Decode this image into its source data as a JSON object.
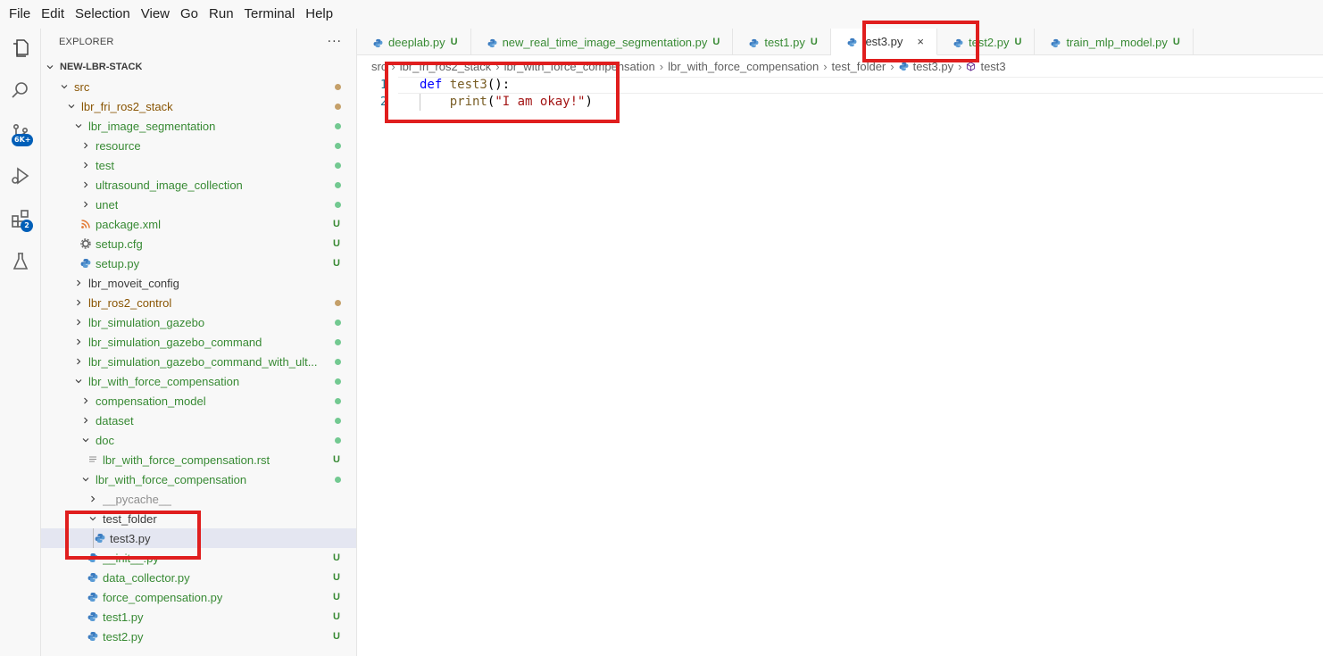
{
  "menu": [
    "File",
    "Edit",
    "Selection",
    "View",
    "Go",
    "Run",
    "Terminal",
    "Help"
  ],
  "activity": {
    "icons": [
      "explorer-icon",
      "search-icon",
      "source-control-icon",
      "run-debug-icon",
      "extensions-icon",
      "testing-icon"
    ],
    "scm_badge": "6K+",
    "extensions_badge": "2"
  },
  "sidebar": {
    "title": "EXPLORER",
    "more": "···",
    "tree": [
      {
        "label": "NEW-LBR-STACK",
        "indent": 0,
        "chevron": "down",
        "color": "c-bold",
        "deco": "",
        "dot": ""
      },
      {
        "label": "src",
        "indent": 1,
        "chevron": "down",
        "color": "c-olive",
        "deco": "",
        "dot": "#c5a06a"
      },
      {
        "label": "lbr_fri_ros2_stack",
        "indent": 2,
        "chevron": "down",
        "color": "c-olive",
        "deco": "",
        "dot": "#c5a06a"
      },
      {
        "label": "lbr_image_segmentation",
        "indent": 3,
        "chevron": "down",
        "color": "c-green",
        "deco": "",
        "dot": "#73c991"
      },
      {
        "label": "resource",
        "indent": 4,
        "chevron": "right",
        "color": "c-green",
        "deco": "",
        "dot": "#73c991"
      },
      {
        "label": "test",
        "indent": 4,
        "chevron": "right",
        "color": "c-green",
        "deco": "",
        "dot": "#73c991"
      },
      {
        "label": "ultrasound_image_collection",
        "indent": 4,
        "chevron": "right",
        "color": "c-green",
        "deco": "",
        "dot": "#73c991"
      },
      {
        "label": "unet",
        "indent": 4,
        "chevron": "right",
        "color": "c-green",
        "deco": "",
        "dot": "#73c991"
      },
      {
        "label": "package.xml",
        "indent": 4,
        "chevron": "",
        "icon": "rss",
        "color": "c-green",
        "deco": "U",
        "dot": ""
      },
      {
        "label": "setup.cfg",
        "indent": 4,
        "chevron": "",
        "icon": "gear",
        "color": "c-green",
        "deco": "U",
        "dot": ""
      },
      {
        "label": "setup.py",
        "indent": 4,
        "chevron": "",
        "icon": "python",
        "color": "c-green",
        "deco": "U",
        "dot": ""
      },
      {
        "label": "lbr_moveit_config",
        "indent": 3,
        "chevron": "right",
        "color": "c-dark",
        "deco": "",
        "dot": ""
      },
      {
        "label": "lbr_ros2_control",
        "indent": 3,
        "chevron": "right",
        "color": "c-olive",
        "deco": "",
        "dot": "#c5a06a"
      },
      {
        "label": "lbr_simulation_gazebo",
        "indent": 3,
        "chevron": "right",
        "color": "c-green",
        "deco": "",
        "dot": "#73c991"
      },
      {
        "label": "lbr_simulation_gazebo_command",
        "indent": 3,
        "chevron": "right",
        "color": "c-green",
        "deco": "",
        "dot": "#73c991"
      },
      {
        "label": "lbr_simulation_gazebo_command_with_ult...",
        "indent": 3,
        "chevron": "right",
        "color": "c-green",
        "deco": "",
        "dot": "#73c991"
      },
      {
        "label": "lbr_with_force_compensation",
        "indent": 3,
        "chevron": "down",
        "color": "c-green",
        "deco": "",
        "dot": "#73c991"
      },
      {
        "label": "compensation_model",
        "indent": 4,
        "chevron": "right",
        "color": "c-green",
        "deco": "",
        "dot": "#73c991"
      },
      {
        "label": "dataset",
        "indent": 4,
        "chevron": "right",
        "color": "c-green",
        "deco": "",
        "dot": "#73c991"
      },
      {
        "label": "doc",
        "indent": 4,
        "chevron": "down",
        "color": "c-green",
        "deco": "",
        "dot": "#73c991"
      },
      {
        "label": "lbr_with_force_compensation.rst",
        "indent": 5,
        "chevron": "",
        "icon": "lines",
        "color": "c-green",
        "deco": "U",
        "dot": ""
      },
      {
        "label": "lbr_with_force_compensation",
        "indent": 4,
        "chevron": "down",
        "color": "c-green",
        "deco": "",
        "dot": "#73c991"
      },
      {
        "label": "__pycache__",
        "indent": 5,
        "chevron": "right",
        "color": "c-gray",
        "deco": "",
        "dot": ""
      },
      {
        "label": "test_folder",
        "indent": 5,
        "chevron": "down",
        "color": "c-dark",
        "deco": "",
        "dot": ""
      },
      {
        "label": "test3.py",
        "indent": 6,
        "chevron": "",
        "icon": "python",
        "color": "c-dark",
        "deco": "",
        "dot": "",
        "selected": true
      },
      {
        "label": "__init__.py",
        "indent": 5,
        "chevron": "",
        "icon": "python",
        "color": "c-green",
        "deco": "U",
        "dot": ""
      },
      {
        "label": "data_collector.py",
        "indent": 5,
        "chevron": "",
        "icon": "python",
        "color": "c-green",
        "deco": "U",
        "dot": ""
      },
      {
        "label": "force_compensation.py",
        "indent": 5,
        "chevron": "",
        "icon": "python",
        "color": "c-green",
        "deco": "U",
        "dot": ""
      },
      {
        "label": "test1.py",
        "indent": 5,
        "chevron": "",
        "icon": "python",
        "color": "c-green",
        "deco": "U",
        "dot": ""
      },
      {
        "label": "test2.py",
        "indent": 5,
        "chevron": "",
        "icon": "python",
        "color": "c-green",
        "deco": "U",
        "dot": ""
      }
    ]
  },
  "tabs": [
    {
      "label": "deeplab.py",
      "deco": "U",
      "active": false
    },
    {
      "label": "new_real_time_image_segmentation.py",
      "deco": "U",
      "active": false
    },
    {
      "label": "test1.py",
      "deco": "U",
      "active": false
    },
    {
      "label": "test3.py",
      "deco": "",
      "active": true,
      "close": "×"
    },
    {
      "label": "test2.py",
      "deco": "U",
      "active": false
    },
    {
      "label": "train_mlp_model.py",
      "deco": "U",
      "active": false
    }
  ],
  "breadcrumb": [
    "src",
    "lbr_fri_ros2_stack",
    "lbr_with_force_compensation",
    "lbr_with_force_compensation",
    "test_folder",
    "test3.py",
    "test3"
  ],
  "code": {
    "lines": [
      {
        "num": "1",
        "tokens": [
          {
            "t": "def ",
            "c": "kw"
          },
          {
            "t": "test3",
            "c": "fn"
          },
          {
            "t": "():",
            "c": "plain"
          }
        ]
      },
      {
        "num": "2",
        "tokens": [
          {
            "t": "    ",
            "c": "plain"
          },
          {
            "t": "print",
            "c": "fn"
          },
          {
            "t": "(",
            "c": "plain"
          },
          {
            "t": "\"I am okay!\"",
            "c": "str"
          },
          {
            "t": ")",
            "c": "plain"
          }
        ]
      }
    ]
  },
  "colors": {
    "accent": "#005fb8",
    "highlight_red": "#e01e1e",
    "untracked_green": "#388a34"
  }
}
